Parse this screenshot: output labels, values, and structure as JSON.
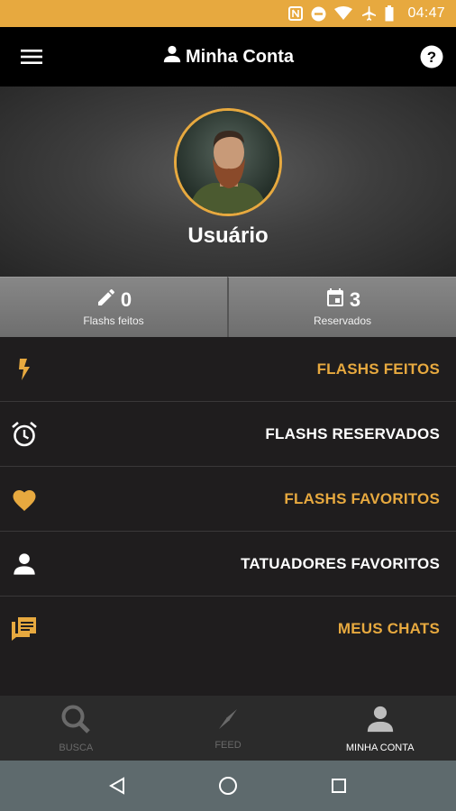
{
  "status_bar": {
    "time": "04:47",
    "icons": [
      "nfc-icon",
      "do-not-disturb-icon",
      "wifi-icon",
      "airplane-icon",
      "battery-icon"
    ],
    "background": "#e7a93f"
  },
  "app_bar": {
    "title": "Minha Conta",
    "left_icon": "menu-icon",
    "title_icon": "person-icon",
    "right_icon": "help-icon"
  },
  "profile": {
    "username": "Usuário",
    "avatar": "user-avatar-photo"
  },
  "stats": [
    {
      "icon": "pencil-icon",
      "value": "0",
      "label": "Flashs feitos"
    },
    {
      "icon": "calendar-icon",
      "value": "3",
      "label": "Reservados"
    }
  ],
  "menu": [
    {
      "icon": "lightning-icon",
      "label": "FLASHS FEITOS",
      "color": "#e7a93f"
    },
    {
      "icon": "alarm-clock-icon",
      "label": "FLASHS RESERVADOS",
      "color": "#ffffff"
    },
    {
      "icon": "heart-icon",
      "label": "FLASHS FAVORITOS",
      "color": "#e7a93f"
    },
    {
      "icon": "person-icon",
      "label": "TATUADORES FAVORITOS",
      "color": "#ffffff"
    },
    {
      "icon": "chat-icon",
      "label": "MEUS CHATS",
      "color": "#e7a93f"
    }
  ],
  "bottom_nav": [
    {
      "icon": "search-icon",
      "label": "BUSCA",
      "active": false
    },
    {
      "icon": "compass-icon",
      "label": "FEED",
      "active": false
    },
    {
      "icon": "person-icon",
      "label": "MINHA CONTA",
      "active": true
    }
  ],
  "system_nav": [
    "back-icon",
    "home-icon",
    "recents-icon"
  ],
  "colors": {
    "accent": "#e7a93f",
    "background": "#1f1d1e",
    "app_bar": "#000000"
  }
}
